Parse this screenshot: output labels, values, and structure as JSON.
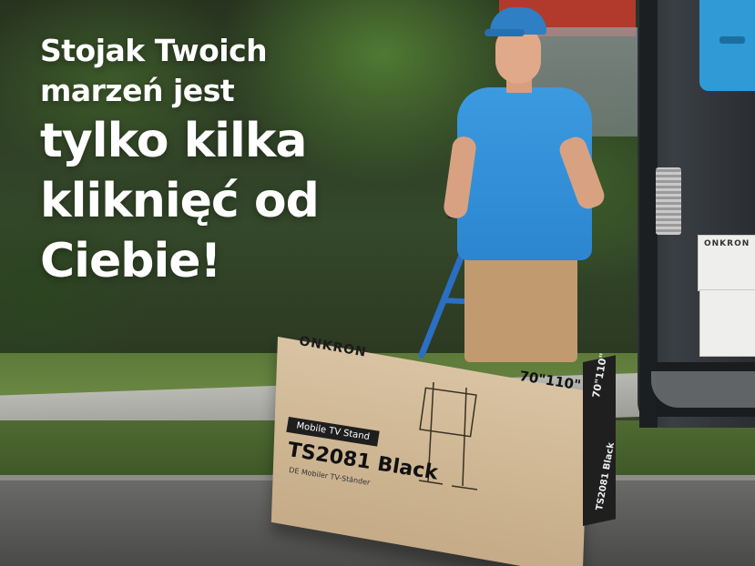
{
  "headline": {
    "line1": "Stojak Twoich",
    "line2": "marzeń jest",
    "line3": "tylko kilka",
    "line4": "kliknięć od",
    "line5": "Ciebie!"
  },
  "product_box": {
    "brand": "ONKRON",
    "size": "70\"110\"",
    "category_label": "Mobile TV Stand",
    "model": "TS2081 Black",
    "subtitle": "DE Mobiler TV-Ständer",
    "side_model": "TS2081 Black",
    "side_size": "70\"110\""
  },
  "van": {
    "box_brand": "ONKRON"
  },
  "colors": {
    "headline_text": "#ffffff",
    "shirt": "#2c86cf",
    "box": "#c5ab87",
    "van_blue": "#2f9ad6"
  }
}
